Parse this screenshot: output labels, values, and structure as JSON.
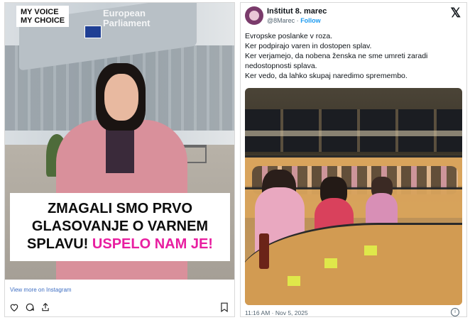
{
  "instagram": {
    "brand_line1": "MY VOICE",
    "brand_line2": "MY CHOICE",
    "building_text_line1": "European",
    "building_text_line2": "Parliament",
    "headline_part1": "ZMAGALI SMO PRVO GLASOVANJE O VARNEM SPLAVU!",
    "headline_part2": "USPELO NAM JE!",
    "headline_accent_color": "#e81ea0",
    "view_more": "View more on Instagram",
    "icons": [
      "heart-icon",
      "comment-icon",
      "share-icon",
      "bookmark-icon"
    ]
  },
  "tweet": {
    "author_name": "Inštitut 8. marec",
    "handle": "@8Marec",
    "separator": "·",
    "follow_label": "Follow",
    "x_logo": "𝕏",
    "lines": [
      "Evropske poslanke v roza.",
      "Ker podpirajo varen in dostopen splav.",
      "Ker verjamejo, da nobena ženska ne sme umreti zaradi nedostopnosti splava.",
      "Ker vedo, da lahko skupaj naredimo spremembo."
    ],
    "timestamp": "11:16 AM · Nov 5, 2025",
    "info_icon": "i",
    "link_color": "#1d9bf0"
  }
}
